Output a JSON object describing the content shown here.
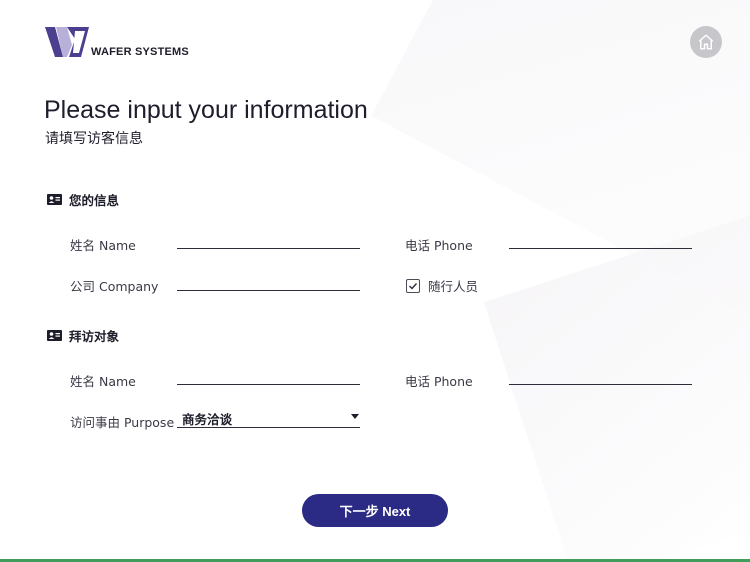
{
  "brand": {
    "name": "WAFER SYSTEMS"
  },
  "header": {
    "title": "Please input your information",
    "subtitle": "请填写访客信息"
  },
  "sections": {
    "visitor": {
      "heading": "您的信息",
      "name_label": "姓名 Name",
      "name_value": "",
      "phone_label": "电话 Phone",
      "phone_value": "",
      "company_label": "公司 Company",
      "company_value": "",
      "companion_label": "随行人员",
      "companion_checked": true
    },
    "host": {
      "heading": "拜访对象",
      "name_label": "姓名 Name",
      "name_value": "",
      "phone_label": "电话 Phone",
      "phone_value": "",
      "purpose_label": "访问事由 Purpose",
      "purpose_selected": "商务洽谈"
    }
  },
  "actions": {
    "next_label": "下一步 Next"
  },
  "colors": {
    "primary": "#2b2a85",
    "logo_purple": "#4b3f8f",
    "logo_lavender": "#b8b0d8",
    "home_bg": "#c7c7cb",
    "accent_bottom": "#3f9e5a"
  },
  "icons": {
    "home": "home-icon",
    "section": "id-card-icon",
    "checkbox": "checkmark-icon",
    "dropdown": "caret-down-icon"
  }
}
